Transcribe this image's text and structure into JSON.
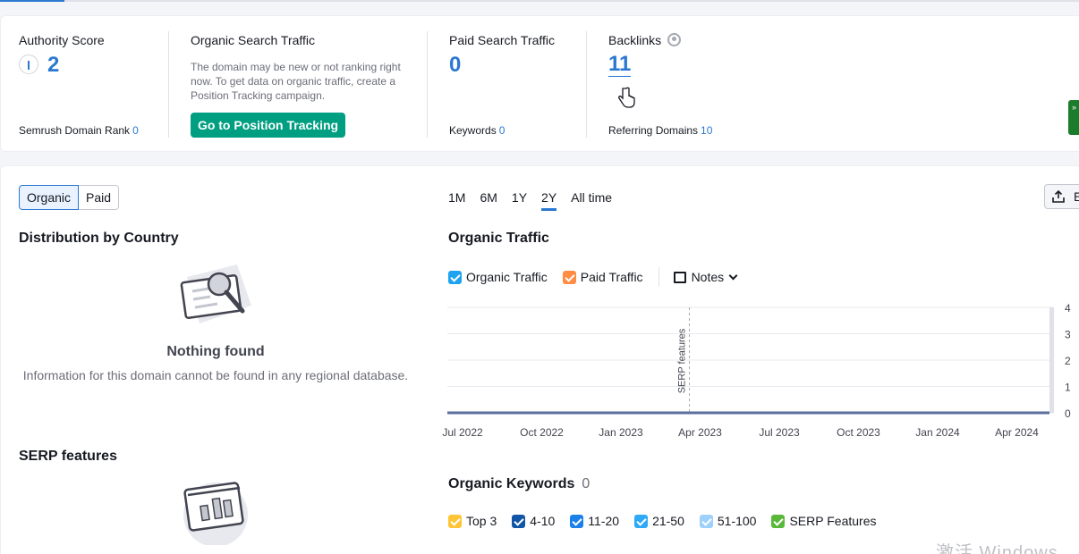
{
  "summary": {
    "authority": {
      "title": "Authority Score",
      "value": "2",
      "rank_label": "Semrush Domain Rank",
      "rank_value": "0"
    },
    "organic": {
      "title": "Organic Search Traffic",
      "note": "The domain may be new or not ranking right now. To get data on organic traffic, create a Position Tracking campaign.",
      "button": "Go to Position Tracking"
    },
    "paid": {
      "title": "Paid Search Traffic",
      "value": "0",
      "keywords_label": "Keywords",
      "keywords_value": "0"
    },
    "backlinks": {
      "title": "Backlinks",
      "value": "11",
      "ref_label": "Referring Domains",
      "ref_value": "10"
    },
    "side_widget": "»"
  },
  "main": {
    "tabs": {
      "organic": "Organic",
      "paid": "Paid"
    },
    "periods": [
      {
        "label": "1M",
        "active": false
      },
      {
        "label": "6M",
        "active": false
      },
      {
        "label": "1Y",
        "active": false
      },
      {
        "label": "2Y",
        "active": true
      },
      {
        "label": "All time",
        "active": false
      }
    ],
    "export_label": "E",
    "distribution": {
      "title": "Distribution by Country",
      "empty_title": "Nothing found",
      "empty_text": "Information for this domain cannot be found in any regional database."
    },
    "serp": {
      "title": "SERP features"
    },
    "traffic": {
      "title": "Organic Traffic",
      "legend": {
        "organic": "Organic Traffic",
        "paid": "Paid Traffic",
        "notes": "Notes"
      }
    },
    "keywords": {
      "title": "Organic Keywords",
      "count": "0",
      "legend": [
        "Top 3",
        "4-10",
        "11-20",
        "21-50",
        "51-100",
        "SERP Features"
      ]
    },
    "watermark": "激活 Windows"
  },
  "colors": {
    "accent": "#2b78d0",
    "green_button": "#009f81",
    "organic": "#1fa2f0",
    "paid": "#ff8c42",
    "top3": "#ffc536",
    "k4_10": "#1156a6",
    "k11_20": "#1b80ea",
    "k21_50": "#2ea9f5",
    "k51_100": "#9dd1fc",
    "serp": "#59b83a"
  },
  "chart_data": {
    "type": "line",
    "title": "Organic Traffic",
    "x": [
      "Jul 2022",
      "Oct 2022",
      "Jan 2023",
      "Apr 2023",
      "Jul 2023",
      "Oct 2023",
      "Jan 2024",
      "Apr 2024"
    ],
    "y_ticks": [
      "0",
      "1",
      "2",
      "3",
      "4"
    ],
    "ylim": [
      0,
      4
    ],
    "series": [
      {
        "name": "Organic Traffic",
        "values": [
          0,
          0,
          0,
          0,
          0,
          0,
          0,
          0
        ]
      },
      {
        "name": "Paid Traffic",
        "values": [
          0,
          0,
          0,
          0,
          0,
          0,
          0,
          0
        ]
      }
    ],
    "annotations": [
      {
        "label": "SERP features",
        "x": "Apr 2023"
      }
    ],
    "grid": true
  }
}
